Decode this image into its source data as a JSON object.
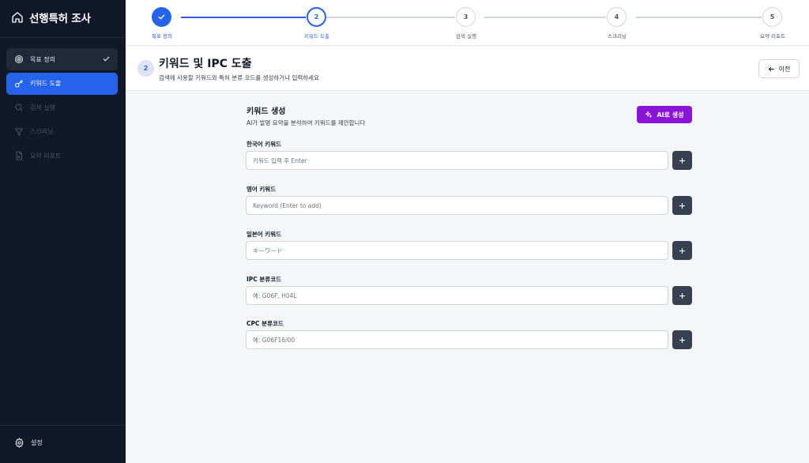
{
  "app": {
    "title": "선행특허 조사"
  },
  "sidebar": {
    "items": [
      {
        "label": "목표 정의",
        "state": "done",
        "icon": "target-icon"
      },
      {
        "label": "키워드 도출",
        "state": "active",
        "icon": "key-icon"
      },
      {
        "label": "검색 실행",
        "state": "pending",
        "icon": "search-icon"
      },
      {
        "label": "스크리닝",
        "state": "pending",
        "icon": "filter-icon"
      },
      {
        "label": "요약 리포트",
        "state": "pending",
        "icon": "document-icon"
      }
    ],
    "settings_label": "설정"
  },
  "stepper": {
    "steps": [
      {
        "number": "",
        "label": "목표 정의",
        "state": "done"
      },
      {
        "number": "2",
        "label": "키워드 도출",
        "state": "active"
      },
      {
        "number": "3",
        "label": "검색 실행",
        "state": "pending"
      },
      {
        "number": "4",
        "label": "스크리닝",
        "state": "pending"
      },
      {
        "number": "5",
        "label": "요약 리포트",
        "state": "pending"
      }
    ]
  },
  "header": {
    "step_number": "2",
    "title": "키워드 및 IPC 도출",
    "subtitle": "검색에 사용할 키워드와 특허 분류 코드를 생성하거나 입력하세요",
    "back_label": "이전"
  },
  "form": {
    "title": "키워드 생성",
    "subtitle": "AI가 발명 요약을 분석하여 키워드를 제안합니다",
    "ai_button_label": "AI로 생성",
    "fields": [
      {
        "label": "한국어 키워드",
        "value": "",
        "placeholder": "키워드 입력 후 Enter"
      },
      {
        "label": "영어 키워드",
        "value": "",
        "placeholder": "Keyword (Enter to add)"
      },
      {
        "label": "일본어 키워드",
        "value": "",
        "placeholder": "キーワード"
      },
      {
        "label": "IPC 분류코드",
        "value": "",
        "placeholder": "예: G06F, H04L"
      },
      {
        "label": "CPC 분류코드",
        "value": "",
        "placeholder": "예: G06F16/00"
      }
    ]
  },
  "colors": {
    "sidebar_bg": "#111827",
    "accent": "#2563eb",
    "ai_button": "#8b14d9",
    "add_button": "#374151"
  }
}
